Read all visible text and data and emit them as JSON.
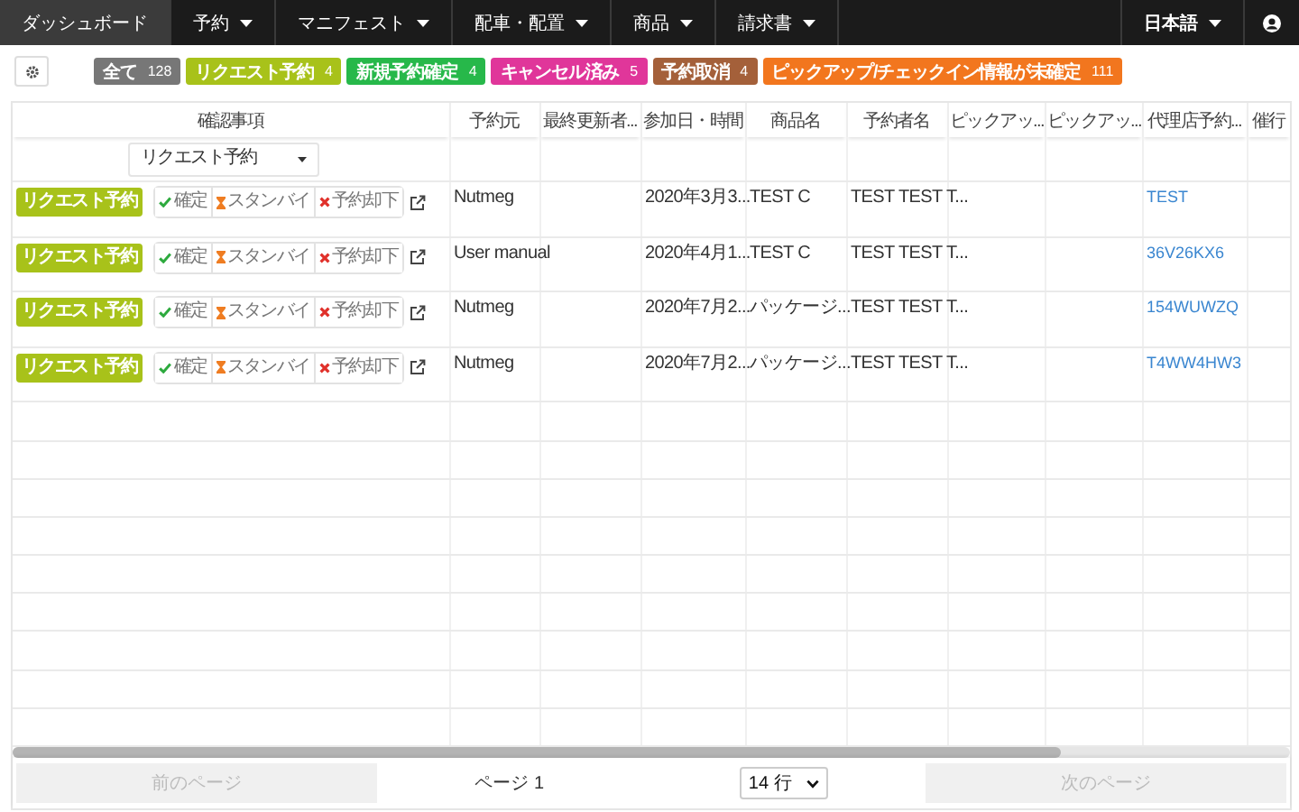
{
  "nav": {
    "items": [
      {
        "label": "ダッシュボード",
        "dropdown": false,
        "selected": true
      },
      {
        "label": "予約",
        "dropdown": true,
        "selected": false
      },
      {
        "label": "マニフェスト",
        "dropdown": true,
        "selected": false
      },
      {
        "label": "配車・配置",
        "dropdown": true,
        "selected": false
      },
      {
        "label": "商品",
        "dropdown": true,
        "selected": false
      },
      {
        "label": "請求書",
        "dropdown": true,
        "selected": false
      }
    ],
    "language": "日本語"
  },
  "filters": [
    {
      "label": "全て",
      "count": "128",
      "color": "#777777"
    },
    {
      "label": "リクエスト予約",
      "count": "4",
      "color": "#a8c21a"
    },
    {
      "label": "新規予約確定",
      "count": "4",
      "color": "#27b84a"
    },
    {
      "label": "キャンセル済み",
      "count": "5",
      "color": "#e0369a"
    },
    {
      "label": "予約取消",
      "count": "4",
      "color": "#a4603a"
    },
    {
      "label": "ピックアップ/チェックイン情報が未確定",
      "count": "111",
      "color": "#f2761e"
    }
  ],
  "table": {
    "columns": [
      "確認事項",
      "予約元",
      "最終更新者...",
      "参加日・時間",
      "商品名",
      "予約者名",
      "ピックアッ...",
      "ピックアッ...",
      "代理店予約...",
      "催行"
    ],
    "status_filter": "リクエスト予約",
    "rows": [
      {
        "actions": [
          {
            "kind": "confirm",
            "label": "確定"
          },
          {
            "kind": "standby",
            "label": "スタンバイ"
          },
          {
            "kind": "reject",
            "label": "予約却下"
          }
        ],
        "cells": [
          "リクエスト予約",
          "Nutmeg",
          null,
          "2020年3月3...",
          "TEST C",
          "TEST TEST T...",
          null,
          null,
          "TEST",
          null
        ]
      },
      {
        "actions": [
          {
            "kind": "confirm",
            "label": "確定"
          },
          {
            "kind": "standby",
            "label": "スタンバイ"
          },
          {
            "kind": "reject",
            "label": "予約却下"
          }
        ],
        "cells": [
          "リクエスト予約",
          "User manual",
          null,
          "2020年4月1...",
          "TEST C",
          "TEST TEST T...",
          null,
          null,
          "36V26KX6",
          null
        ]
      },
      {
        "actions": [
          {
            "kind": "confirm",
            "label": "確定"
          },
          {
            "kind": "standby",
            "label": "スタンバイ"
          },
          {
            "kind": "reject",
            "label": "予約却下"
          }
        ],
        "cells": [
          "リクエスト予約",
          "Nutmeg",
          null,
          "2020年7月2...",
          "パッケージ...",
          "TEST TEST T...",
          null,
          null,
          "154WUWZQ",
          null
        ]
      },
      {
        "actions": [
          {
            "kind": "confirm",
            "label": "確定"
          },
          {
            "kind": "standby",
            "label": "スタンバイ"
          },
          {
            "kind": "reject",
            "label": "予約却下"
          }
        ],
        "cells": [
          "リクエスト予約",
          "Nutmeg",
          null,
          "2020年7月2...",
          "パッケージ...",
          "TEST TEST T...",
          null,
          null,
          "T4WW4HW3",
          null
        ]
      }
    ]
  },
  "pagination": {
    "previous": {
      "label": "前のページ",
      "disabled": true
    },
    "page": "ページ 1",
    "rows_select": "14 行",
    "next": {
      "label": "次のページ",
      "disabled": true
    }
  }
}
